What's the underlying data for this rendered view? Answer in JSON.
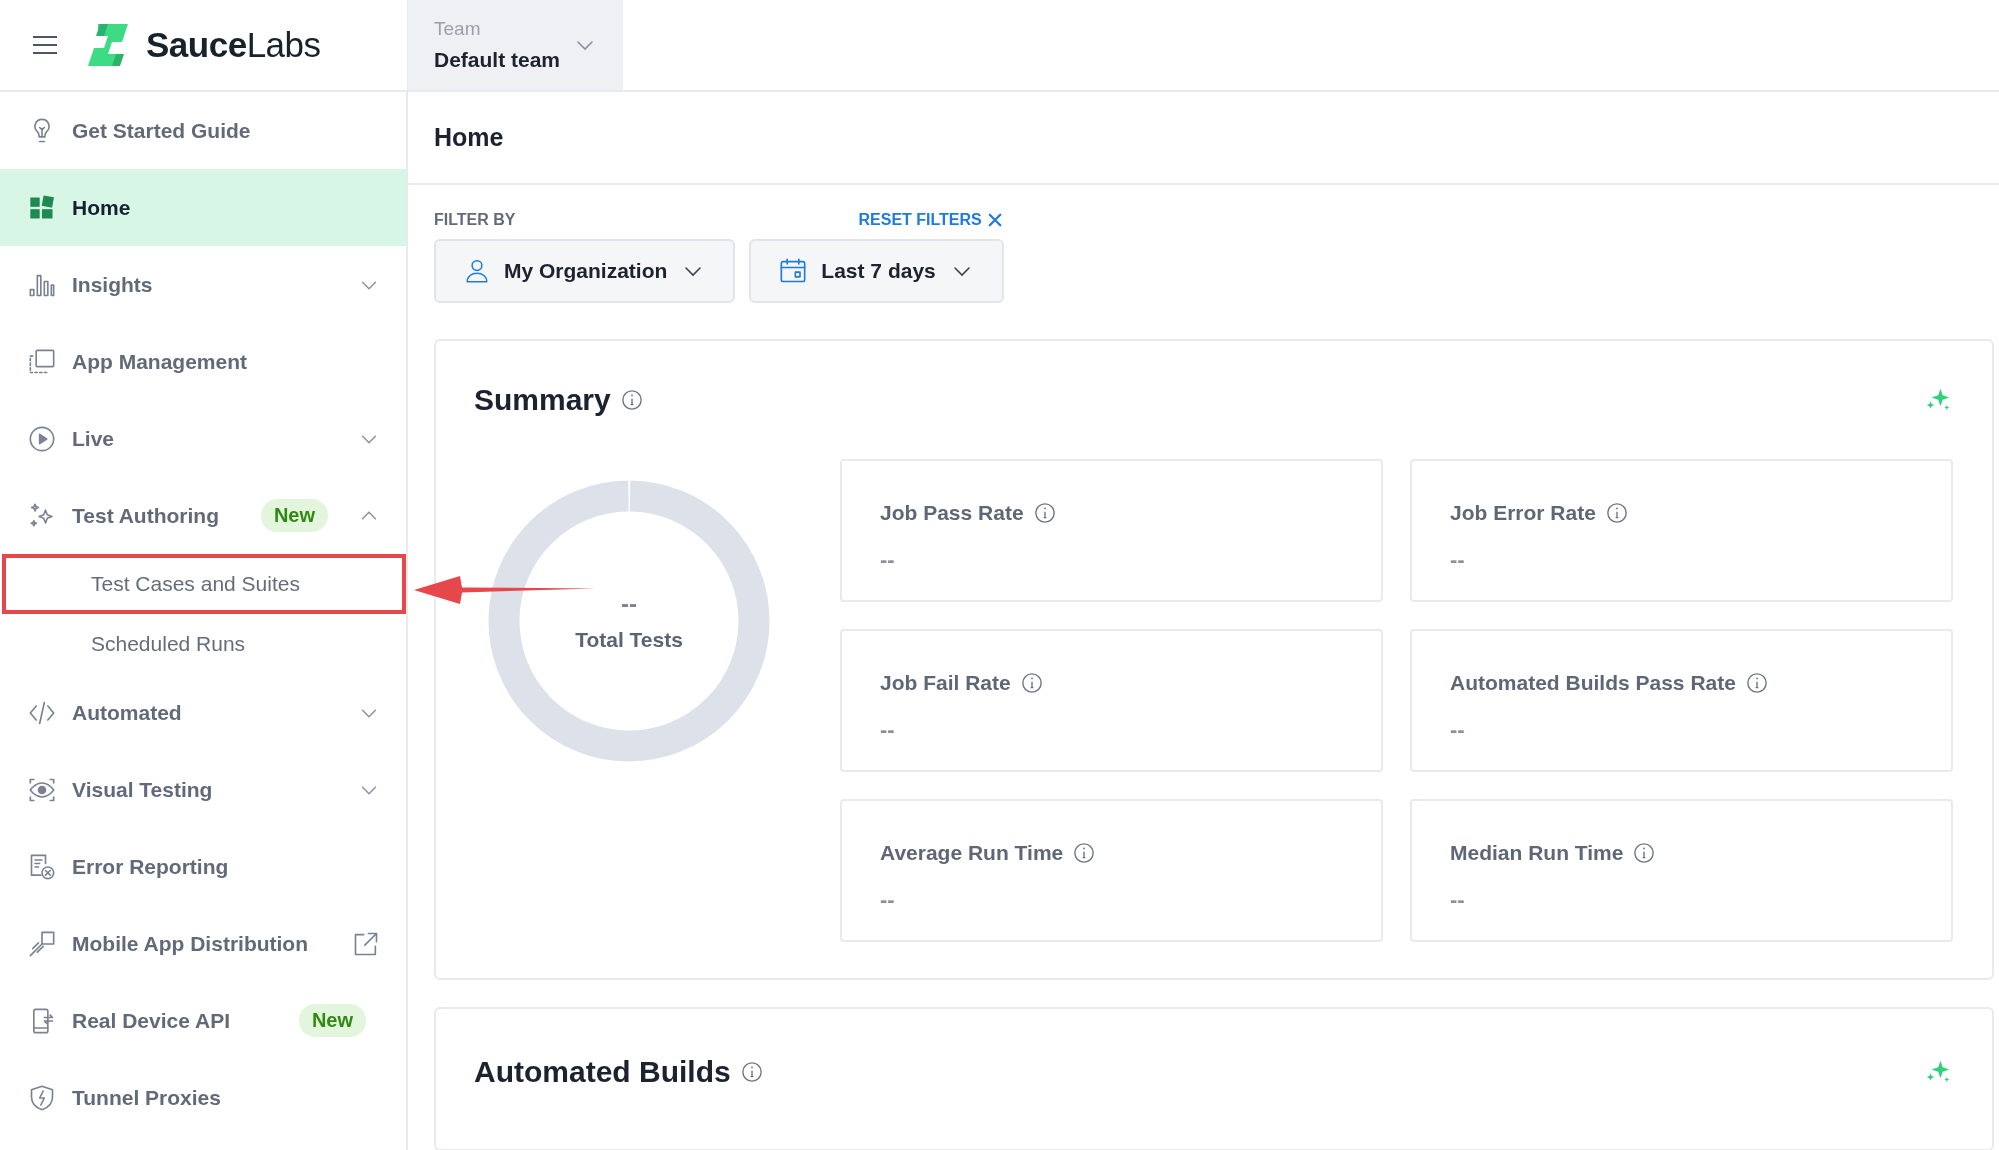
{
  "header": {
    "logo": "**Sauce**Labs",
    "team": {
      "label": "Team",
      "value": "Default team"
    }
  },
  "sidebar": {
    "items": [
      {
        "label": "Get Started Guide",
        "selected": false
      },
      {
        "label": "Home",
        "selected": true
      },
      {
        "label": "Insights",
        "selected": false,
        "expanded": false
      },
      {
        "label": "App Management",
        "selected": false
      },
      {
        "label": "Live",
        "selected": false,
        "expanded": false
      },
      {
        "label": "Test Authoring",
        "selected": false,
        "badge": "New",
        "expanded": true,
        "children": [
          {
            "label": "Test Cases and Suites",
            "selected": false,
            "highlighted": true
          },
          {
            "label": "Scheduled Runs",
            "selected": false,
            "highlighted": false
          }
        ]
      },
      {
        "label": "Automated",
        "selected": false,
        "expanded": false
      },
      {
        "label": "Visual Testing",
        "selected": false,
        "expanded": false
      },
      {
        "label": "Error Reporting",
        "selected": false
      },
      {
        "label": "Mobile App Distribution",
        "selected": false,
        "external": true
      },
      {
        "label": "Real Device API",
        "selected": false,
        "badge": "New"
      },
      {
        "label": "Tunnel Proxies",
        "selected": false
      }
    ]
  },
  "page": {
    "title": "Home"
  },
  "filters": {
    "label": "FILTER BY",
    "reset": "RESET FILTERS",
    "dropdowns": [
      {
        "kind": "organization",
        "value": "My Organization"
      },
      {
        "kind": "date",
        "value": "Last 7 days"
      }
    ]
  },
  "summary": {
    "title": "Summary",
    "total": {
      "value": "--",
      "label": "Total Tests"
    },
    "stats": [
      {
        "label": "Job Pass Rate",
        "value": "--"
      },
      {
        "label": "Job Error Rate",
        "value": "--"
      },
      {
        "label": "Job Fail Rate",
        "value": "--"
      },
      {
        "label": "Automated Builds Pass Rate",
        "value": "--"
      },
      {
        "label": "Average Run Time",
        "value": "--"
      },
      {
        "label": "Median Run Time",
        "value": "--"
      }
    ]
  },
  "automated_builds": {
    "title": "Automated Builds"
  }
}
